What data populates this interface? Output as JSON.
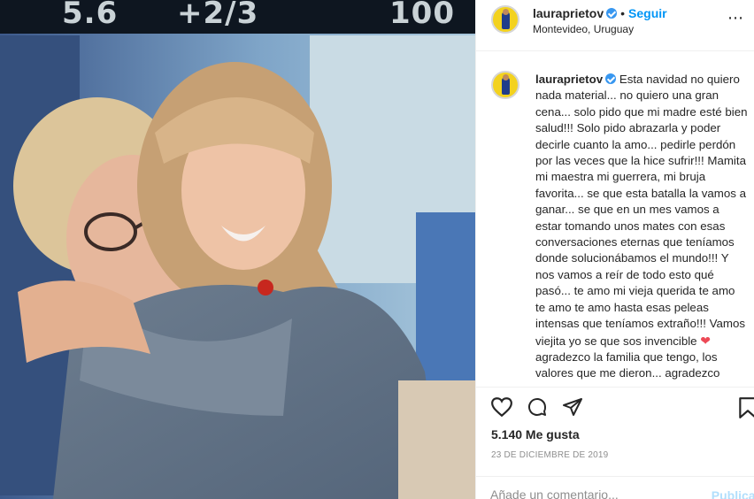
{
  "photo": {
    "alt": "",
    "banner_readouts": [
      "5.6",
      "+2/3",
      "100"
    ]
  },
  "post": {
    "username": "lauraprietov",
    "follow_label": "Seguir",
    "location": "Montevideo, Uruguay",
    "more_icon": "more-icon",
    "caption": "Esta navidad no quiero nada material... no quiero una gran cena... solo pido que mi madre esté bien salud!!! Solo pido abrazarla y poder decirle cuanto la amo... pedirle perdón por las veces que la hice sufrir!!! Mamita mi maestra mi guerrera, mi bruja favorita... se que esta batalla la vamos a ganar... se que en un mes vamos a estar tomando unos mates con esas conversaciones eternas que teníamos donde solucionábamos el mundo!!! Y nos vamos a reír de todo esto qué pasó... te amo mi vieja querida te amo te amo te amo hasta esas peleas intensas que teníamos extraño!!! Vamos viejita yo se que sos invencible",
    "caption_heart": "❤",
    "caption_tail": "agradezco la familia que tengo, los valores que me dieron... agradezco",
    "likes": "5.140 Me gusta",
    "date": "23 DE DICIEMBRE DE 2019",
    "comment_placeholder": "Añade un comentario...",
    "publish_label": "Publicar"
  },
  "icons": {
    "like": "heart-icon",
    "comment": "comment-icon",
    "share": "share-icon",
    "save": "bookmark-icon",
    "verified": "verified-badge-icon"
  },
  "colors": {
    "link_blue": "#0095f6",
    "verified_blue": "#3897f0",
    "heart_red": "#ed4956",
    "muted": "#8e8e8e",
    "publish_disabled": "#b2dffc"
  }
}
